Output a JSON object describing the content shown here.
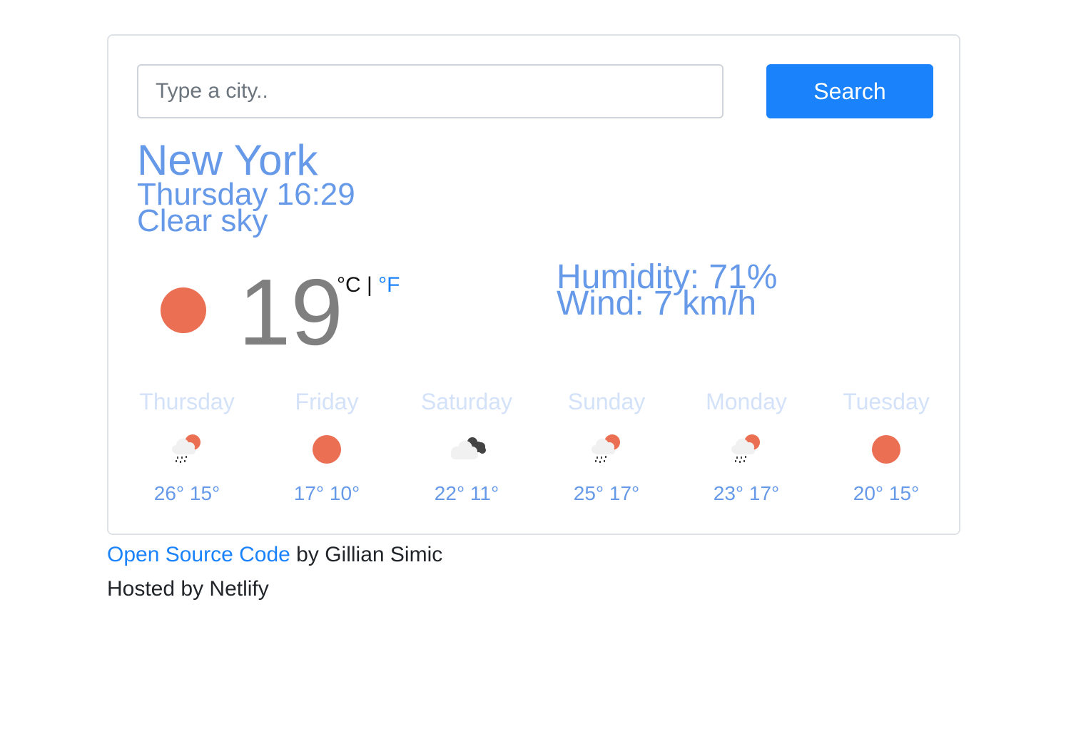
{
  "search": {
    "placeholder": "Type a city..",
    "value": "",
    "button_label": "Search"
  },
  "current": {
    "city": "New York",
    "datetime": "Thursday 16:29",
    "description": "Clear sky",
    "icon": "sun-icon",
    "temperature": "19",
    "unit_celsius": "°C",
    "unit_separator": " | ",
    "unit_fahrenheit": "°F",
    "humidity": "Humidity: 71%",
    "wind": "Wind: 7 km/h"
  },
  "forecast": [
    {
      "day": "Thursday",
      "icon": "sun-rain-cloud-icon",
      "temps": "26° 15°"
    },
    {
      "day": "Friday",
      "icon": "sun-icon",
      "temps": "17° 10°"
    },
    {
      "day": "Saturday",
      "icon": "broken-clouds-icon",
      "temps": "22° 11°"
    },
    {
      "day": "Sunday",
      "icon": "sun-rain-cloud-icon",
      "temps": "25° 17°"
    },
    {
      "day": "Monday",
      "icon": "sun-rain-cloud-icon",
      "temps": "23° 17°"
    },
    {
      "day": "Tuesday",
      "icon": "sun-icon",
      "temps": "20° 15°"
    }
  ],
  "footer": {
    "link_text": "Open Source Code",
    "author_text": " by Gillian Simic",
    "hosted_text": "Hosted by Netlify"
  },
  "colors": {
    "accent": "#1a82fb",
    "text_blue": "#6699e8",
    "sun": "#ea6f53"
  }
}
